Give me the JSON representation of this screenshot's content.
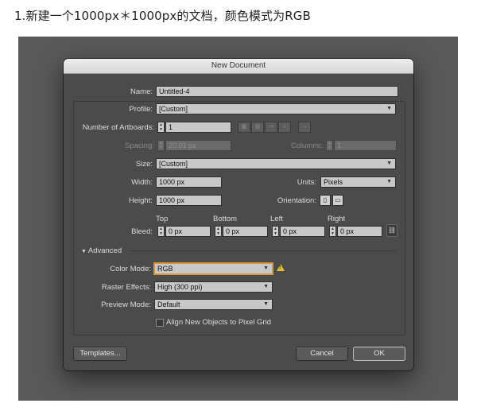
{
  "caption": "1.新建一个1000px＊1000px的文档，颜色模式为RGB",
  "dialog": {
    "title": "New Document",
    "name_label": "Name:",
    "name_value": "Untitled-4",
    "profile_label": "Profile:",
    "profile_value": "[Custom]",
    "artboards_label": "Number of Artboards:",
    "artboards_value": "1",
    "spacing_label": "Spacing:",
    "spacing_value": "20.01 px",
    "columns_label": "Columns:",
    "columns_value": "1",
    "size_label": "Size:",
    "size_value": "[Custom]",
    "width_label": "Width:",
    "width_value": "1000 px",
    "units_label": "Units:",
    "units_value": "Pixels",
    "height_label": "Height:",
    "height_value": "1000 px",
    "orientation_label": "Orientation:",
    "bleed_label": "Bleed:",
    "bleed": [
      {
        "label": "Top",
        "value": "0 px"
      },
      {
        "label": "Bottom",
        "value": "0 px"
      },
      {
        "label": "Left",
        "value": "0 px"
      },
      {
        "label": "Right",
        "value": "0 px"
      }
    ],
    "advanced_label": "Advanced",
    "color_mode_label": "Color Mode:",
    "color_mode_value": "RGB",
    "raster_label": "Raster Effects:",
    "raster_value": "High (300 ppi)",
    "preview_label": "Preview Mode:",
    "preview_value": "Default",
    "align_label": "Align New Objects to Pixel Grid",
    "templates_label": "Templates...",
    "cancel_label": "Cancel",
    "ok_label": "OK"
  },
  "icons": {
    "warning": "warning-triangle-icon",
    "caret": "chevron-down-icon",
    "link": "chain-link-icon"
  },
  "colors": {
    "focus_accent": "#d9963a",
    "warning": "#e6c229",
    "stage": "#595959",
    "dialog": "#4b4b4b"
  }
}
